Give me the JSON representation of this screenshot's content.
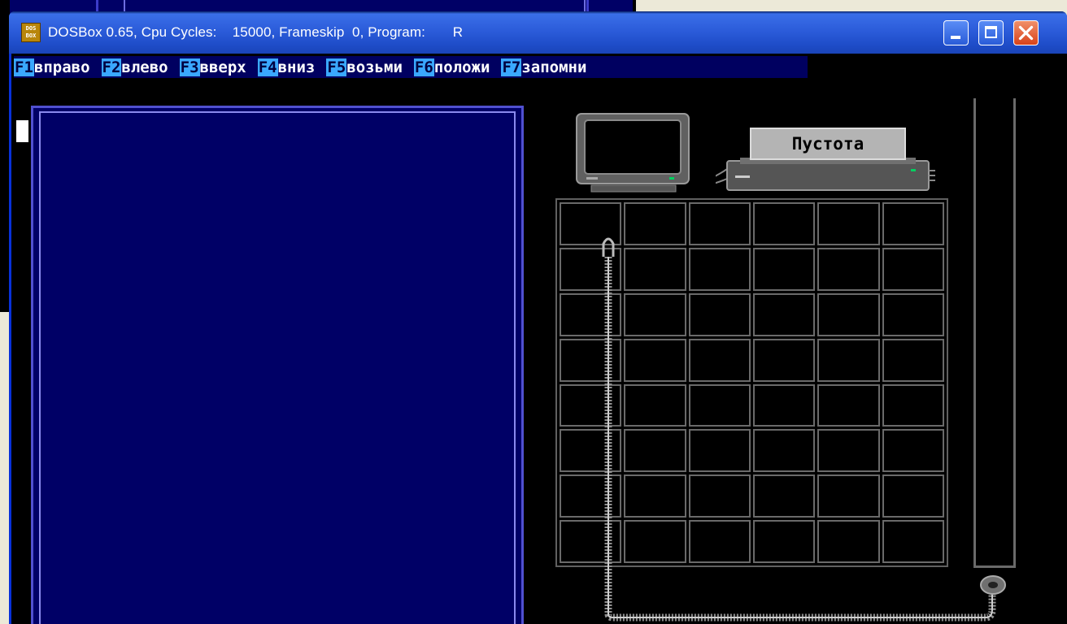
{
  "window": {
    "title": "DOSBox 0.65, Cpu Cycles:    15000, Frameskip  0, Program:       R",
    "icon": "dosbox-icon",
    "icon_text_top": "DOS",
    "icon_text_bottom": "BOX",
    "controls": [
      "minimize-icon",
      "maximize-icon",
      "close-icon"
    ]
  },
  "function_keys": [
    {
      "key": "F1",
      "label": "вправо"
    },
    {
      "key": "F2",
      "label": "влево"
    },
    {
      "key": "F3",
      "label": "вверх"
    },
    {
      "key": "F4",
      "label": "вниз"
    },
    {
      "key": "F5",
      "label": "возьми"
    },
    {
      "key": "F6",
      "label": "положи"
    },
    {
      "key": "F7",
      "label": "запомни"
    }
  ],
  "printer": {
    "paper_text": "Пустота"
  },
  "grid": {
    "columns": 6,
    "rows": 8
  },
  "colors": {
    "dos_blue": "#000066",
    "fkey_highlight": "#3aa8ff",
    "grid_line": "#6a6a6a"
  }
}
